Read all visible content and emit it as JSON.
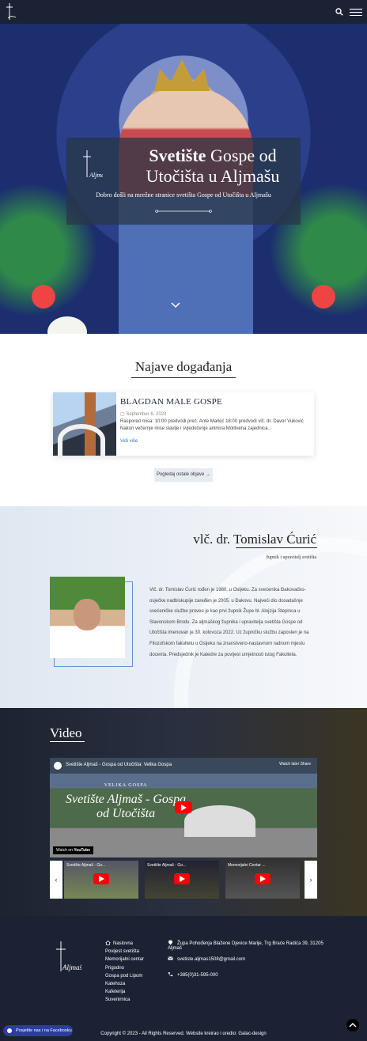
{
  "nav": {
    "logo_icon": "cross-logo-icon",
    "search_icon": "search-icon",
    "menu_icon": "hamburger-icon"
  },
  "hero": {
    "title_bold": "Svetište",
    "title_rest": " Gospe od Utočišta u Aljmašu",
    "subtitle": "Dobro došli na mrežne stranice svetišta Gospe od Utočišta u Aljmašu",
    "logo_text": "Aljmaš",
    "scroll_icon": "chevron-down-icon"
  },
  "events": {
    "heading": "Najave događanja",
    "items": [
      {
        "title": "BLAGDAN MALE GOSPE",
        "date": "September 6, 2023",
        "description": "Raspored misa: 10:00 predvodi preč. Ante Markić 18:00 predvodi vlč. dr. Davor Vuković Nakon večernje mise slavlje i svjedočenje animira Molitvena zajednica...",
        "more": "Vidi više"
      }
    ],
    "button": "Pogledaj ostale objave →"
  },
  "priest": {
    "name": "vlč. dr. Tomislav Ćurić",
    "role": "župnik i upravitelj svetišta",
    "bio": "Vlč. dr. Tomislav Ćurić rođen je 1980. u Osijeku. Za svećenika Đakovačko-osječke nadbiskupije zaređen je 2005. u Đakovu. Najveći dio dosadašnje svećeničke službe proveo je kao prvi župnik Župe bl. Alojzija Stepinca u Slavonskom Brodu. Za aljmaškog župnika i upravitelja svetišta Gospe od Utočišta imenovan je 30. kolovoza 2022. Uz župničku službu zaposlen je na Filozofskom fakultetu u Osijeku na znanstveno-nastavnom radnom mjestu docenta. Predsjednik je Katedre za povijest umjetnosti istog Fakulteta."
  },
  "video": {
    "heading": "Video",
    "main_title": "Svetište Aljmaš - Gospa od Utočišta: Velika Gospa",
    "overlay_small": "VELIKA GOSPA",
    "overlay_line1": "Svetište Aljmaš - Gospa",
    "overlay_line2": "od Utočišta",
    "watch_label": "Watch on",
    "youtube_label": "YouTube",
    "watch_later": "Watch later",
    "share": "Share",
    "playlist": [
      {
        "title": "Svetište Aljmaš - Go..."
      },
      {
        "title": "Svetište Aljmaš - Go..."
      },
      {
        "title": "Memorijalni Centar ..."
      }
    ],
    "prev_icon": "chevron-left-icon",
    "next_icon": "chevron-right-icon"
  },
  "footer": {
    "logo_text": "Aljmaš",
    "menu": [
      "Naslovna",
      "Povijest svetišta",
      "Memorijalni centar",
      "Prigodno",
      "Gospa pod Lipom",
      "Katehoza",
      "Kafeterija",
      "Suvenirnica"
    ],
    "address": "Župa Pohođenja Blažene Djevice Marije, Trg Braće Radića 39, 31205 Aljmaš",
    "email": "svetiste.aljmas1508@gmail.com",
    "phone": "+385(0)31-595-000",
    "copyright": "Copyright © 2023 - All Rights Reserved. Website kreirao i uredio: Galac-design",
    "facebook": "Posjetite nas i na Facebooku"
  }
}
